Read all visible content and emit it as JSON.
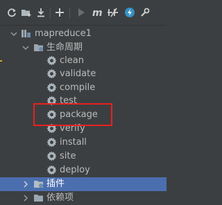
{
  "toolbar": {
    "icons": [
      "refresh-icon",
      "add-maven-project-icon",
      "download-icon",
      "plus-icon",
      "run-icon",
      "maven-goal-icon",
      "skip-tests-icon",
      "lightning-icon",
      "settings-icon"
    ]
  },
  "tree": {
    "project": "mapreduce1",
    "lifecycle": {
      "label": "生命周期",
      "phases": [
        "clean",
        "validate",
        "compile",
        "test",
        "package",
        "verify",
        "install",
        "site",
        "deploy"
      ]
    },
    "plugins": "插件",
    "dependencies_partial": "依赖项"
  },
  "colors": {
    "background": "#3c3f41",
    "selection": "#4b6eaf",
    "highlight_box": "#e8211f"
  }
}
